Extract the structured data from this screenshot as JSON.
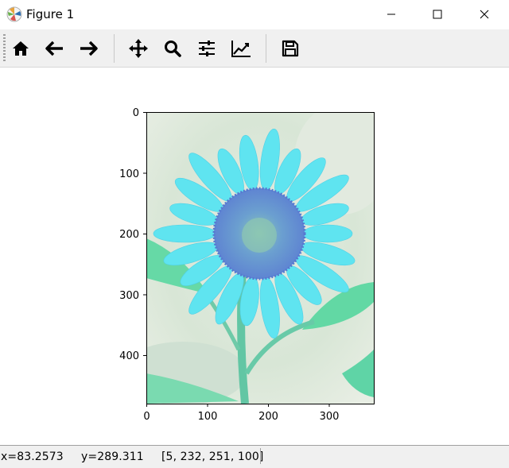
{
  "window": {
    "title": "Figure 1"
  },
  "toolbar": {
    "buttons": [
      {
        "name": "home",
        "icon": "home-icon"
      },
      {
        "name": "back",
        "icon": "arrow-left-icon"
      },
      {
        "name": "forward",
        "icon": "arrow-right-icon"
      },
      {
        "name": "pan",
        "icon": "move-icon"
      },
      {
        "name": "zoom",
        "icon": "magnifier-icon"
      },
      {
        "name": "subplots",
        "icon": "sliders-icon"
      },
      {
        "name": "customize",
        "icon": "line-chart-icon"
      },
      {
        "name": "save",
        "icon": "floppy-disk-icon"
      }
    ]
  },
  "plot": {
    "image_description_colors": {
      "background": "#dce8dc",
      "petals": "#5ee6f0",
      "center": "#6f9bd6",
      "leaves": "#58dba0"
    },
    "x_axis": {
      "ticks": [
        0,
        100,
        200,
        300
      ],
      "range": [
        0,
        374
      ]
    },
    "y_axis": {
      "ticks": [
        0,
        100,
        200,
        300,
        400
      ],
      "range": [
        0,
        480
      ],
      "inverted": true
    }
  },
  "status": {
    "x": "x=83.2573",
    "y": "y=289.311",
    "pixel": "[5, 232, 251, 100]"
  }
}
